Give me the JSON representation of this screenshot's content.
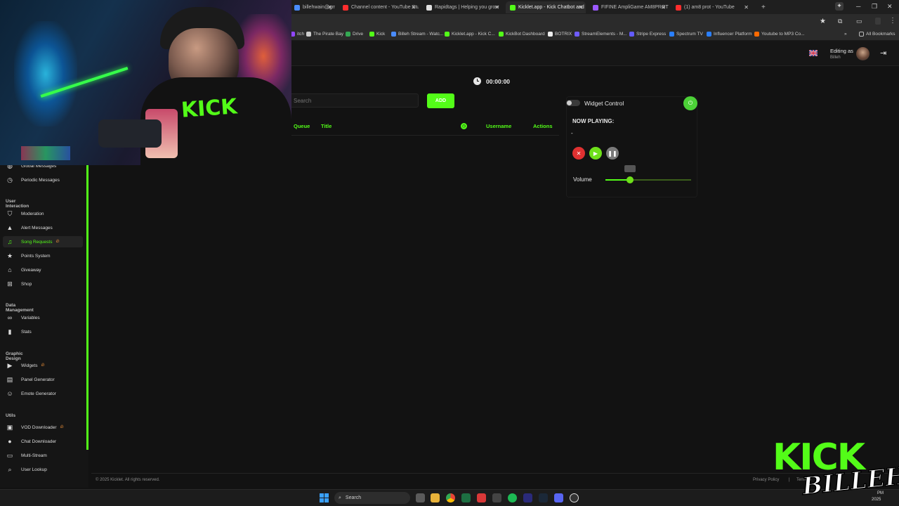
{
  "browser": {
    "tabs": [
      {
        "label": "billehwain@gmail",
        "fav": "#4a8cff"
      },
      {
        "label": "Channel content - YouTube Stu",
        "fav": "#ff2d2d"
      },
      {
        "label": "Rapidtags | Helping you grow",
        "fav": "#e0e0e0"
      },
      {
        "label": "Kicklet.app - Kick Chatbot and",
        "fav": "#53fc18"
      },
      {
        "label": "FIFINE AmpliGame AM8PROT",
        "fav": "#9b59ff"
      },
      {
        "label": "(1) am8 prot - YouTube",
        "fav": "#ff2d2d"
      }
    ],
    "new_tab": "+",
    "bookmarks": [
      {
        "label": "itch",
        "fav": "#9146ff"
      },
      {
        "label": "The Pirate Bay",
        "fav": "#cccccc"
      },
      {
        "label": "Drive",
        "fav": "#34a853"
      },
      {
        "label": "Kick",
        "fav": "#53fc18"
      },
      {
        "label": "Billeh Stream - Watc...",
        "fav": "#4a8cff"
      },
      {
        "label": "Kicklet.app - Kick C...",
        "fav": "#53fc18"
      },
      {
        "label": "KickBot Dashboard",
        "fav": "#53fc18"
      },
      {
        "label": "BOTRIX",
        "fav": "#eeeeee"
      },
      {
        "label": "StreamElements - M...",
        "fav": "#6f5cff"
      },
      {
        "label": "Stripe Express",
        "fav": "#635bff"
      },
      {
        "label": "Spectrum TV",
        "fav": "#2a7fff"
      },
      {
        "label": "Influencer Platform",
        "fav": "#2a7fff"
      },
      {
        "label": "Youtube to MP3 Co...",
        "fav": "#ff6a00"
      }
    ],
    "all_bookmarks": "All Bookmarks"
  },
  "header": {
    "editing_as_label": "Editing as",
    "user_name": "Billeh"
  },
  "timer": "00:00:00",
  "search": {
    "placeholder": "Search"
  },
  "add_label": "ADD",
  "table": {
    "headers": {
      "queue": "Queue",
      "title": "Title",
      "username": "Username",
      "actions": "Actions"
    }
  },
  "widget": {
    "control_label": "Widget Control",
    "now_playing_label": "NOW PLAYING:",
    "now_playing_value": "-",
    "volume_label": "Volume",
    "volume_value": 0.29
  },
  "sidebar": {
    "sections": [
      {
        "title": "",
        "items": [
          {
            "label": "Global Messages",
            "icon": "globe-icon"
          },
          {
            "label": "Periodic Messages",
            "icon": "clock-icon"
          }
        ]
      },
      {
        "title": "User Interaction",
        "items": [
          {
            "label": "Moderation",
            "icon": "shield-icon"
          },
          {
            "label": "Alert Messages",
            "icon": "warning-icon"
          },
          {
            "label": "Song Requests",
            "icon": "music-icon",
            "active": true,
            "hot": true
          },
          {
            "label": "Points System",
            "icon": "star-icon"
          },
          {
            "label": "Giveaway",
            "icon": "gift-icon"
          },
          {
            "label": "Shop",
            "icon": "cart-icon"
          }
        ]
      },
      {
        "title": "Data Management",
        "items": [
          {
            "label": "Variables",
            "icon": "link-icon"
          },
          {
            "label": "Stats",
            "icon": "chart-icon"
          }
        ]
      },
      {
        "title": "Graphic Design",
        "items": [
          {
            "label": "Widgets",
            "icon": "video-icon",
            "hot": true
          },
          {
            "label": "Panel Generator",
            "icon": "panel-icon"
          },
          {
            "label": "Emote Generator",
            "icon": "smile-icon"
          }
        ]
      },
      {
        "title": "Utils",
        "items": [
          {
            "label": "VOD Downloader",
            "icon": "film-icon",
            "hot": true
          },
          {
            "label": "Chat Downloader",
            "icon": "chat-icon"
          },
          {
            "label": "Multi-Stream",
            "icon": "screen-icon"
          },
          {
            "label": "User Lookup",
            "icon": "search-icon"
          }
        ]
      }
    ]
  },
  "footer": {
    "copyright": "© 2025 Kicklet. All rights reserved.",
    "privacy": "Privacy Policy",
    "separator": "|",
    "terms": "Terms o"
  },
  "taskbar": {
    "search": "Search",
    "time": "PM",
    "date": "2025"
  },
  "overlay": {
    "brand_top": "KICK",
    "brand_bottom": "BILLEH"
  },
  "colors": {
    "accent": "#53fc18",
    "danger": "#e03131",
    "bg": "#121212"
  }
}
